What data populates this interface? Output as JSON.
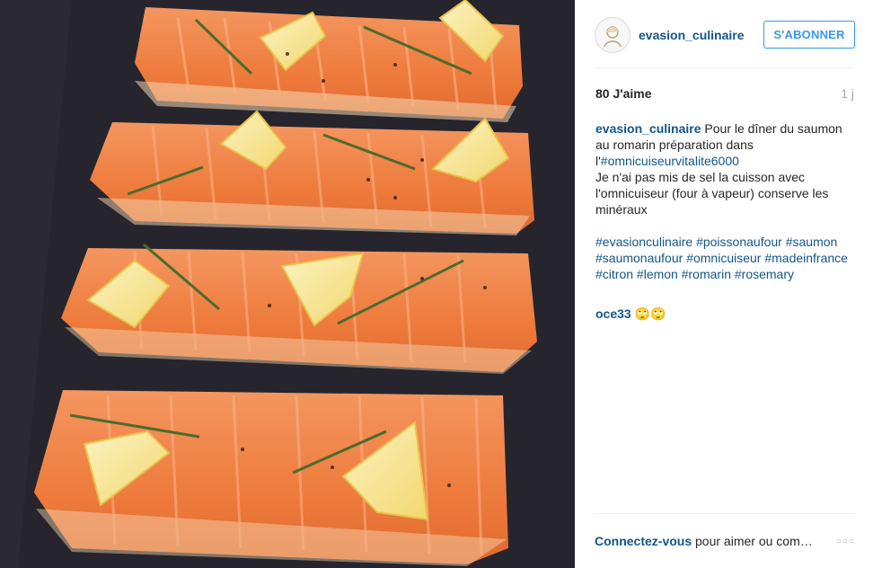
{
  "post": {
    "image_alt": "Pavés de saumon au romarin et citron",
    "colors": {
      "salmon": "#f0803f",
      "lemon": "#f6e59a",
      "rosemary": "#4b6b2e",
      "tray": "#23222a"
    }
  },
  "header": {
    "avatar_icon": "avatar-icon",
    "username": "evasion_culinaire",
    "follow_label": "S'ABONNER"
  },
  "stats": {
    "likes": "80 J'aime",
    "time": "1 j"
  },
  "caption": {
    "author": "evasion_culinaire",
    "line1": " Pour le dîner du saumon au romarin préparation dans l'",
    "tag1": "#omnicuiseurvitalite6000",
    "line2": "Je n'ai pas mis de sel la cuisson avec l'omnicuiseur (four à vapeur) conserve les minéraux",
    "hashtags": [
      "#evasionculinaire",
      "#poissonaufour",
      "#saumon",
      "#saumonaufour",
      "#omnicuiseur",
      "#madeinfrance",
      "#citron",
      "#lemon",
      "#romarin",
      "#rosemary"
    ]
  },
  "comments": [
    {
      "author": "oce33",
      "text": " 🙄🙄"
    }
  ],
  "footer": {
    "login_label": "Connectez-vous",
    "prompt": " pour aimer ou commenter.",
    "more_icon": "more-options-icon"
  }
}
